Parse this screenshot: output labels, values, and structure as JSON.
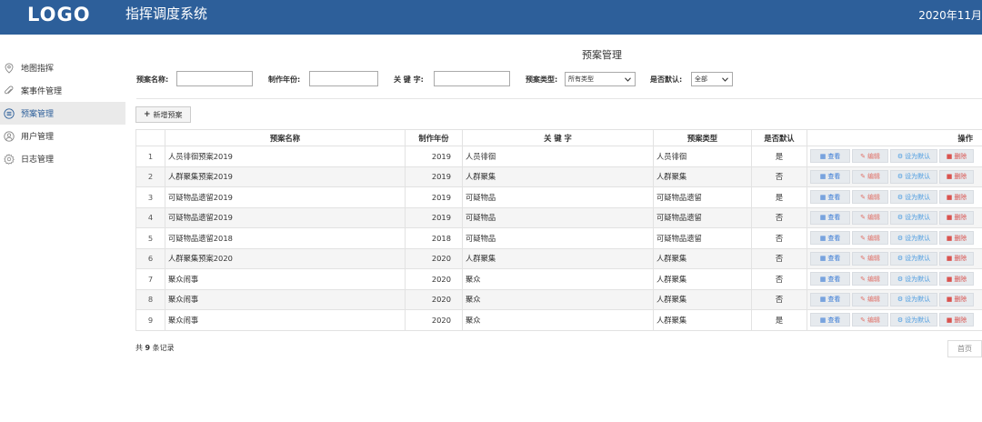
{
  "header": {
    "logo": "LOGO",
    "title": "指挥调度系统",
    "date": "2020年11月"
  },
  "sidebar": {
    "items": [
      {
        "label": "地图指挥",
        "icon": "map-pin-icon"
      },
      {
        "label": "案事件管理",
        "icon": "paperclip-icon"
      },
      {
        "label": "预案管理",
        "icon": "list-icon"
      },
      {
        "label": "用户管理",
        "icon": "user-icon"
      },
      {
        "label": "日志管理",
        "icon": "gear-icon"
      }
    ]
  },
  "page": {
    "title": "预案管理"
  },
  "search": {
    "name_label": "预案名称:",
    "year_label": "制作年份:",
    "keyword_label": "关 键 字:",
    "type_label": "预案类型:",
    "type_value": "所有类型",
    "default_label": "是否默认:",
    "default_value": "全部"
  },
  "toolbar": {
    "add_label": "新增预案"
  },
  "table": {
    "headers": {
      "name": "预案名称",
      "year": "制作年份",
      "keyword": "关 键 字",
      "type": "预案类型",
      "default": "是否默认",
      "ops": "操作"
    },
    "rows": [
      {
        "num": "1",
        "name": "人员徘徊预案2019",
        "year": "2019",
        "keyword": "人员徘徊",
        "type": "人员徘徊",
        "default": "是"
      },
      {
        "num": "2",
        "name": "人群聚集预案2019",
        "year": "2019",
        "keyword": "人群聚集",
        "type": "人群聚集",
        "default": "否"
      },
      {
        "num": "3",
        "name": "可疑物品遗留2019",
        "year": "2019",
        "keyword": "可疑物品",
        "type": "可疑物品遗留",
        "default": "是"
      },
      {
        "num": "4",
        "name": "可疑物品遗留2019",
        "year": "2019",
        "keyword": "可疑物品",
        "type": "可疑物品遗留",
        "default": "否"
      },
      {
        "num": "5",
        "name": "可疑物品遗留2018",
        "year": "2018",
        "keyword": "可疑物品",
        "type": "可疑物品遗留",
        "default": "否"
      },
      {
        "num": "6",
        "name": "人群聚集预案2020",
        "year": "2020",
        "keyword": "人群聚集",
        "type": "人群聚集",
        "default": "否"
      },
      {
        "num": "7",
        "name": "聚众闹事",
        "year": "2020",
        "keyword": "聚众",
        "type": "人群聚集",
        "default": "否"
      },
      {
        "num": "8",
        "name": "聚众闹事",
        "year": "2020",
        "keyword": "聚众",
        "type": "人群聚集",
        "default": "否"
      },
      {
        "num": "9",
        "name": "聚众闹事",
        "year": "2020",
        "keyword": "聚众",
        "type": "人群聚集",
        "default": "是"
      }
    ],
    "actions": {
      "view": "查看",
      "edit": "编辑",
      "set_default": "设为默认",
      "delete": "删除"
    }
  },
  "footer": {
    "count_prefix": "共",
    "count": "9",
    "count_suffix": "条记录",
    "first_page": "首页"
  }
}
